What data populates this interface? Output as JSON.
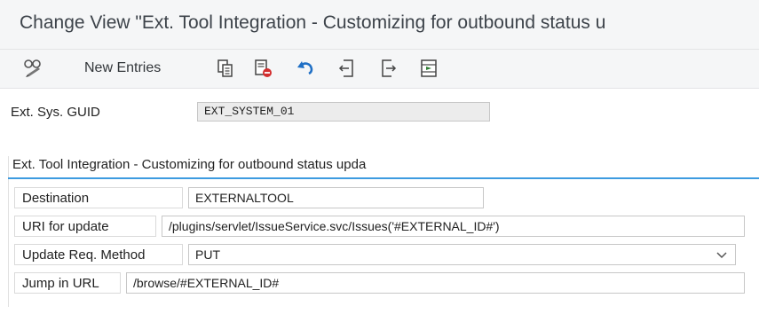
{
  "window": {
    "title": "Change View \"Ext. Tool Integration - Customizing for outbound status u"
  },
  "toolbar": {
    "new_entries_label": "New Entries",
    "icons": [
      "display-change-icon",
      "copy-icon",
      "delete-icon",
      "undo-icon",
      "previous-entry-icon",
      "next-entry-icon",
      "select-all-icon"
    ]
  },
  "header": {
    "guid_label": "Ext. Sys. GUID",
    "guid_value": "EXT_SYSTEM_01"
  },
  "group": {
    "title": "Ext. Tool Integration - Customizing for outbound status upda",
    "destination_label": "Destination",
    "destination_value": "EXTERNALTOOL",
    "uri_label": "URI for update",
    "uri_value": "/plugins/servlet/IssueService.svc/Issues('#EXTERNAL_ID#')",
    "method_label": "Update Req. Method",
    "method_value": "PUT",
    "jump_label": "Jump in URL",
    "jump_value": "/browse/#EXTERNAL_ID#"
  },
  "colors": {
    "accent": "#3d9be0",
    "toolbar_bg": "#f5f6f7",
    "readonly_bg": "#ececec",
    "delete_red": "#d32f2f",
    "undo_blue": "#1f6fc5"
  }
}
